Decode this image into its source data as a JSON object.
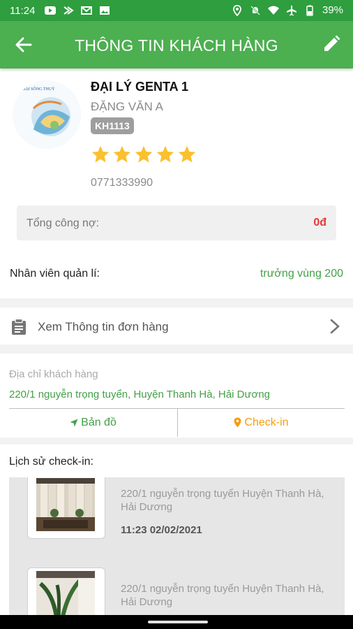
{
  "status_bar": {
    "time": "11:24",
    "battery": "39%",
    "left_icons": [
      "youtube-icon",
      "app-icon",
      "gmail-icon",
      "image-icon"
    ],
    "right_icons": [
      "location-icon",
      "mute-icon",
      "wifi-icon",
      "airplane-icon",
      "battery-icon"
    ]
  },
  "appbar": {
    "title": "THÔNG TIN KHÁCH HÀNG",
    "back_icon": "arrow-left-icon",
    "edit_icon": "pencil-icon",
    "color": "#4caf50"
  },
  "customer": {
    "name": "ĐẠI LÝ GENTA 1",
    "owner": "ĐẶNG VĂN A",
    "code": "KH1113",
    "rating": 5,
    "rating_max": 5,
    "phone": "0771333990"
  },
  "debt": {
    "label": "Tổng công nợ:",
    "value": "0đ"
  },
  "manager": {
    "label": "Nhân viên quản lí:",
    "value": "trưởng vùng 200"
  },
  "orders": {
    "label": "Xem Thông tin đơn hàng"
  },
  "address": {
    "label": "Địa chỉ khách hàng",
    "value": "220/1 nguyễn trọng tuyển, Huyện Thanh Hà, Hải Dương"
  },
  "actions": {
    "map_label": "Bản đồ",
    "checkin_label": "Check-in"
  },
  "history": {
    "label": "Lịch sử check-in:",
    "items": [
      {
        "address": "220/1 nguyễn trọng tuyển Huyện Thanh Hà, Hải Dương",
        "time": "11:23 02/02/2021"
      },
      {
        "address": "220/1 nguyễn trọng tuyển Huyện Thanh Hà, Hải Dương",
        "time": ""
      }
    ]
  },
  "colors": {
    "green": "#43a047",
    "red": "#e53935",
    "orange": "#f59e0b",
    "star": "#fbc02d"
  }
}
